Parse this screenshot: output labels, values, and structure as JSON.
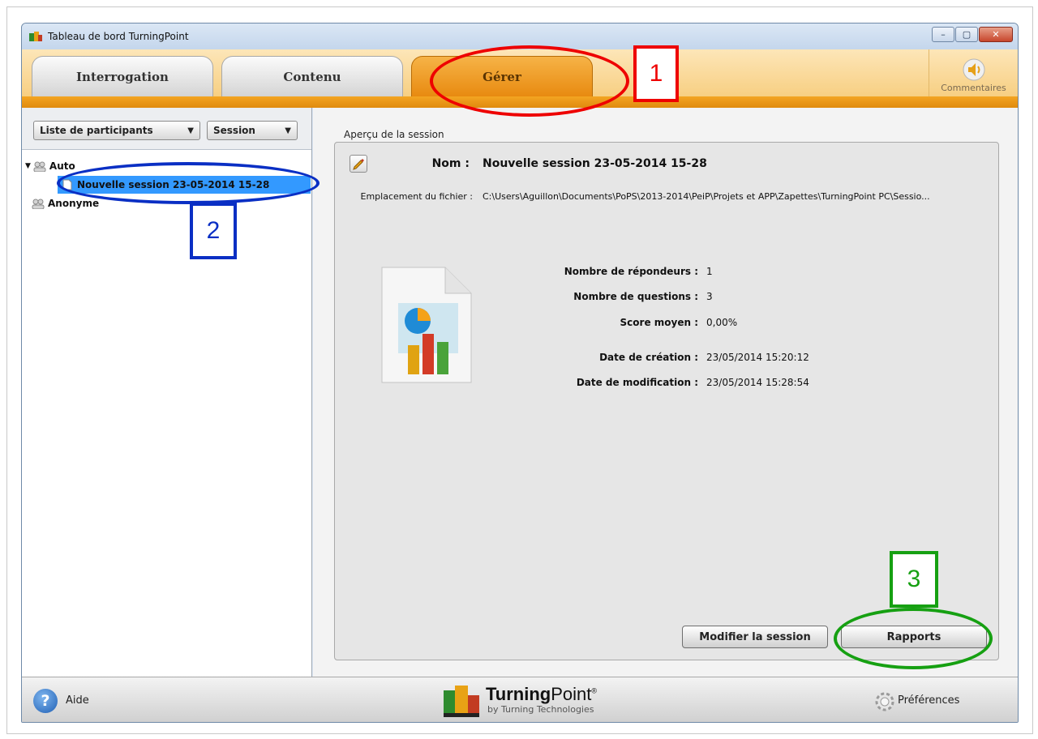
{
  "window": {
    "title": "Tableau de bord TurningPoint",
    "controls": {
      "minimize": "–",
      "maximize": "▢",
      "close": "✕"
    }
  },
  "tabs": [
    {
      "label": "Interrogation"
    },
    {
      "label": "Contenu"
    },
    {
      "label": "Gérer",
      "active": true
    }
  ],
  "comments": {
    "label": "Commentaires",
    "icon": "speaker-icon"
  },
  "left_pane": {
    "dropdown_participants": "Liste de participants",
    "dropdown_session": "Session",
    "tree": {
      "auto": "Auto",
      "session": "Nouvelle session 23-05-2014 15-28",
      "anonymous": "Anonyme"
    }
  },
  "preview": {
    "section_label": "Aperçu de la session",
    "name_label": "Nom :",
    "name_value": "Nouvelle session 23-05-2014 15-28",
    "path_label": "Emplacement du fichier :",
    "path_value": "C:\\Users\\Aguillon\\Documents\\PoPS\\2013-2014\\PeiP\\Projets et APP\\Zapettes\\TurningPoint PC\\Sessio...",
    "stats": [
      {
        "label": "Nombre de répondeurs :",
        "value": "1"
      },
      {
        "label": "Nombre de questions :",
        "value": "3"
      },
      {
        "label": "Score moyen :",
        "value": "0,00%"
      },
      {
        "label": "Date de création :",
        "value": "23/05/2014 15:20:12"
      },
      {
        "label": "Date de modification :",
        "value": "23/05/2014 15:28:54"
      }
    ],
    "modify_button": "Modifier la session",
    "reports_button": "Rapports"
  },
  "footer": {
    "help_label": "Aide",
    "help_glyph": "?",
    "logo_bold": "Turning",
    "logo_regular": "Point",
    "logo_mark": "®",
    "logo_sub": "by Turning Technologies",
    "preferences_label": "Préférences"
  },
  "annotations": {
    "one": "1",
    "two": "2",
    "three": "3"
  },
  "colors": {
    "active_tab": "#e88a10",
    "selection": "#3399ff",
    "annotation_red": "#ee0000",
    "annotation_blue": "#0a2fc4",
    "annotation_green": "#16a012"
  }
}
